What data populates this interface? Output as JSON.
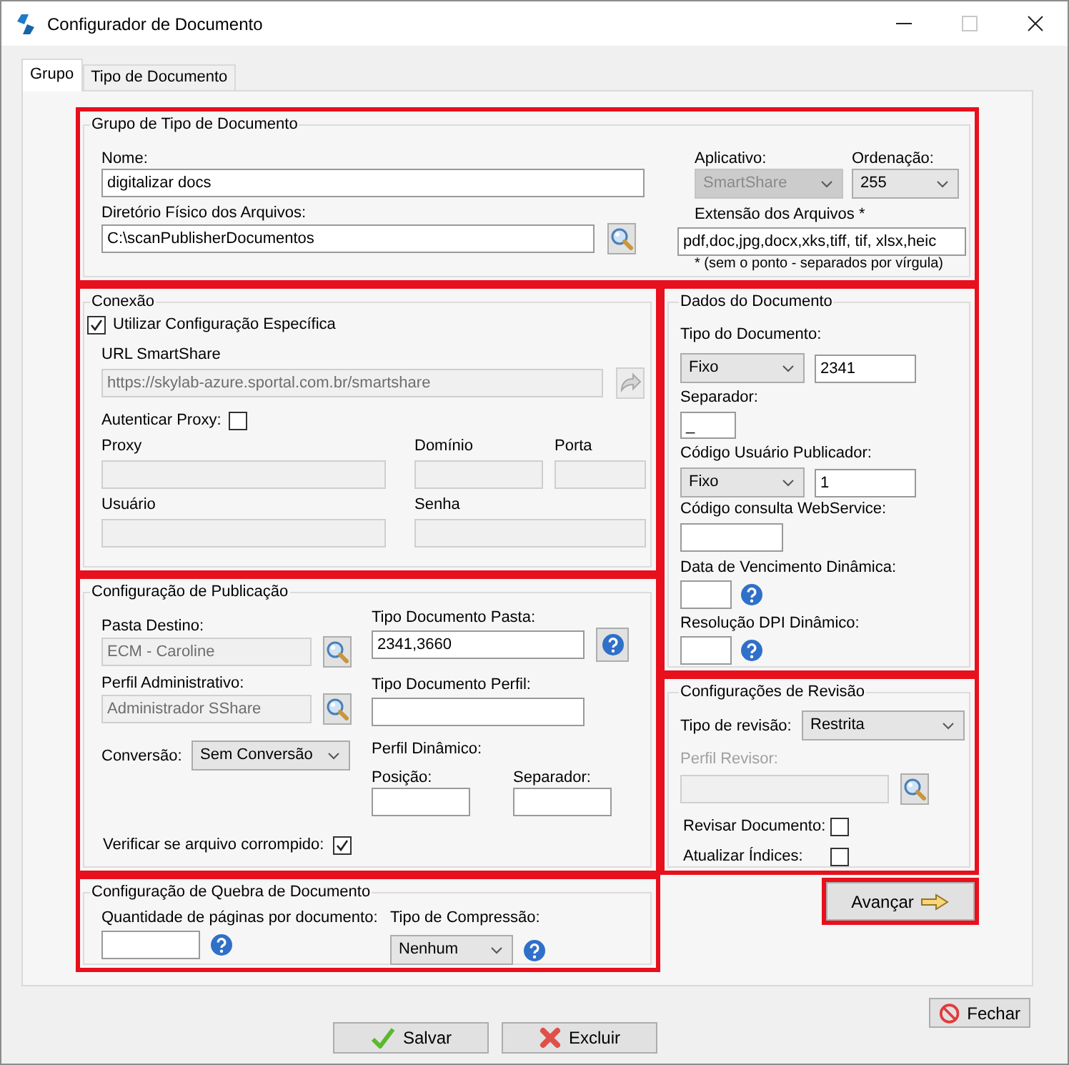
{
  "window": {
    "title": "Configurador de Documento"
  },
  "tabs": [
    {
      "label": "Grupo",
      "selected": true
    },
    {
      "label": "Tipo de Documento",
      "selected": false
    }
  ],
  "grupo": {
    "title": "Grupo de Tipo de Documento",
    "highlighted": true,
    "nome": {
      "label": "Nome:",
      "value": "digitalizar docs"
    },
    "diretorio": {
      "label": "Diretório Físico dos Arquivos:",
      "value": "C:\\scanPublisherDocumentos"
    },
    "aplicativo": {
      "label": "Aplicativo:",
      "value": "SmartShare",
      "disabled": true
    },
    "ordenacao": {
      "label": "Ordenação:",
      "value": "255"
    },
    "extensao": {
      "label": "Extensão dos Arquivos *",
      "value": "pdf,doc,jpg,docx,xks,tiff, tif, xlsx,heic",
      "note": "* (sem o ponto - separados por vírgula)"
    }
  },
  "conexao": {
    "title": "Conexão",
    "highlighted": true,
    "usar": {
      "label": "Utilizar Configuração Específica",
      "checked": true
    },
    "url": {
      "label": "URL SmartShare",
      "value": "https://skylab-azure.sportal.com.br/smartshare",
      "disabled": true
    },
    "autenticar": {
      "label": "Autenticar Proxy:",
      "checked": false
    },
    "proxy": {
      "label": "Proxy",
      "disabled": true
    },
    "dominio": {
      "label": "Domínio",
      "disabled": true
    },
    "porta": {
      "label": "Porta",
      "disabled": true
    },
    "usuario": {
      "label": "Usuário",
      "disabled": true
    },
    "senha": {
      "label": "Senha",
      "disabled": true
    }
  },
  "publicacao": {
    "title": "Configuração de Publicação",
    "highlighted": true,
    "pasta": {
      "label": "Pasta Destino:",
      "value": "ECM - Caroline",
      "disabled": true
    },
    "perfil": {
      "label": "Perfil Administrativo:",
      "value": "Administrador SShare",
      "disabled": true
    },
    "conversao": {
      "label": "Conversão:",
      "value": "Sem Conversão"
    },
    "tipo_pasta": {
      "label": "Tipo Documento Pasta:",
      "value": "2341,3660"
    },
    "tipo_perfil": {
      "label": "Tipo Documento Perfil:"
    },
    "perfil_dinamico": {
      "label": "Perfil Dinâmico:"
    },
    "posicao": {
      "label": "Posição:"
    },
    "separador": {
      "label": "Separador:"
    },
    "verificar": {
      "label": "Verificar se arquivo corrompido:",
      "checked": true
    }
  },
  "quebra": {
    "title": "Configuração de Quebra de Documento",
    "highlighted": true,
    "quantidade": {
      "label": "Quantidade de páginas por documento:"
    },
    "compressao": {
      "label": "Tipo de Compressão:",
      "value": "Nenhum"
    }
  },
  "dados": {
    "title": "Dados do Documento",
    "highlighted": true,
    "tipo": {
      "label": "Tipo do Documento:",
      "mode": "Fixo",
      "value": "2341"
    },
    "separador": {
      "label": "Separador:",
      "value": "_"
    },
    "usuario": {
      "label": "Código Usuário Publicador:",
      "mode": "Fixo",
      "value": "1"
    },
    "webservice": {
      "label": "Código consulta WebService:"
    },
    "vencimento": {
      "label": "Data de Vencimento Dinâmica:"
    },
    "dpi": {
      "label": "Resolução DPI Dinâmico:"
    }
  },
  "revisao": {
    "title": "Configurações de Revisão",
    "highlighted": true,
    "tipo": {
      "label": "Tipo de revisão:",
      "value": "Restrita"
    },
    "perfil": {
      "label": "Perfil Revisor:",
      "disabled": true
    },
    "revisar": {
      "label": "Revisar Documento:",
      "checked": false
    },
    "atualizar": {
      "label": "Atualizar Índices:",
      "checked": false
    }
  },
  "advance_button": {
    "label": "Avançar",
    "highlighted": true
  },
  "footer_buttons": [
    {
      "kind": "close",
      "label": "Fechar"
    },
    {
      "kind": "save",
      "label": "Salvar"
    },
    {
      "kind": "delete",
      "label": "Excluir"
    }
  ]
}
